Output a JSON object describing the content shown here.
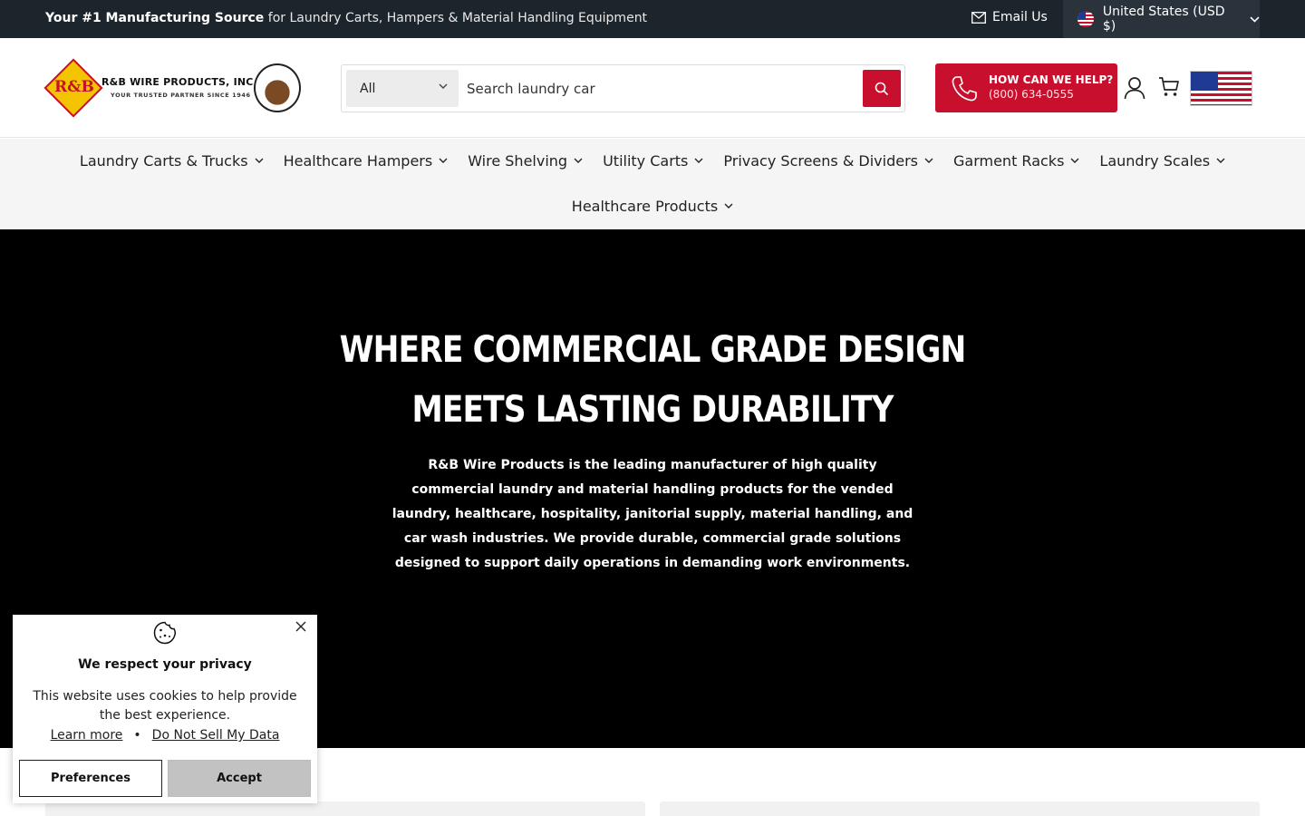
{
  "topbar": {
    "promo_bold": "Your #1 Manufacturing Source",
    "promo_rest": "for Laundry Carts, Hampers & Material Handling Equipment",
    "email_label": "Email Us",
    "country_label": "United States (USD $)"
  },
  "header": {
    "logo_name": "R&B WIRE PRODUCTS, INC.",
    "logo_tagline": "YOUR TRUSTED PARTNER SINCE 1946",
    "logo_mark": "R&B",
    "search": {
      "category": "All",
      "value": "Search laundry car"
    },
    "help": {
      "title": "HOW CAN WE HELP?",
      "phone": "(800) 634-0555"
    }
  },
  "nav": {
    "row1": [
      {
        "label": "Laundry Carts & Trucks"
      },
      {
        "label": "Healthcare Hampers"
      },
      {
        "label": "Wire Shelving"
      },
      {
        "label": "Utility Carts"
      },
      {
        "label": "Privacy Screens & Dividers"
      },
      {
        "label": "Garment Racks"
      },
      {
        "label": "Laundry Scales"
      }
    ],
    "row2": [
      {
        "label": "Healthcare Products"
      }
    ]
  },
  "hero": {
    "heading_line1": "WHERE COMMERCIAL GRADE DESIGN",
    "heading_line2": "MEETS LASTING DURABILITY",
    "body": "R&B Wire Products is the leading manufacturer of high quality commercial laundry and material handling products for the vended laundry, healthcare, hospitality, janitorial supply, material handling, and car wash industries. We provide durable, commercial grade solutions designed to support daily operations in demanding work environments."
  },
  "cookie": {
    "title": "We respect your privacy",
    "message": "This website uses cookies to help provide the best experience.",
    "learn_more": "Learn more",
    "separator": "•",
    "do_not_sell": "Do Not Sell My Data",
    "preferences": "Preferences",
    "accept": "Accept"
  },
  "colors": {
    "brand_red": "#c8102e",
    "topbar_bg": "#1d252c",
    "hero_bg": "#000000"
  }
}
